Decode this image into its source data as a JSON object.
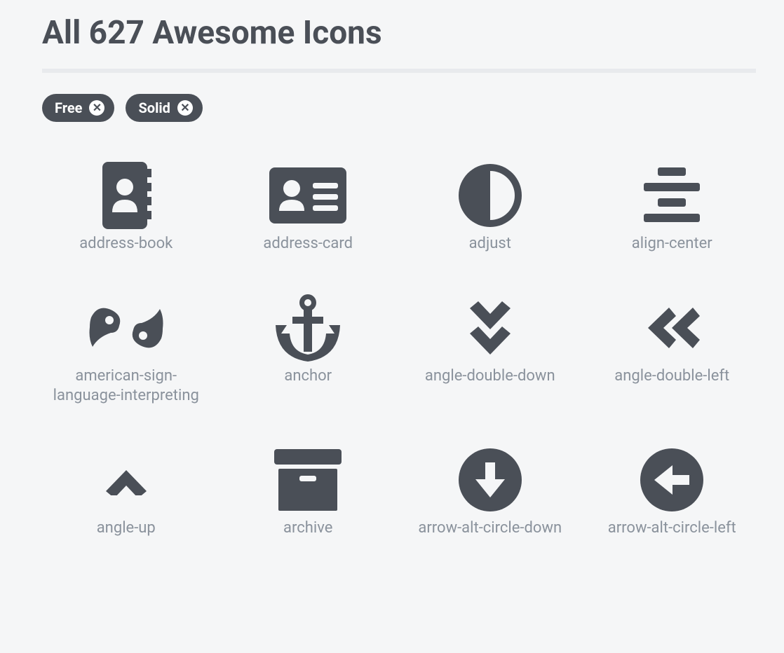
{
  "header": {
    "title": "All 627 Awesome Icons"
  },
  "filters": [
    {
      "label": "Free"
    },
    {
      "label": "Solid"
    }
  ],
  "icons": [
    {
      "name": "address-book"
    },
    {
      "name": "address-card"
    },
    {
      "name": "adjust"
    },
    {
      "name": "align-center"
    },
    {
      "name": "american-sign-language-interpreting"
    },
    {
      "name": "anchor"
    },
    {
      "name": "angle-double-down"
    },
    {
      "name": "angle-double-left"
    },
    {
      "name": "angle-up"
    },
    {
      "name": "archive"
    },
    {
      "name": "arrow-alt-circle-down"
    },
    {
      "name": "arrow-alt-circle-left"
    }
  ]
}
